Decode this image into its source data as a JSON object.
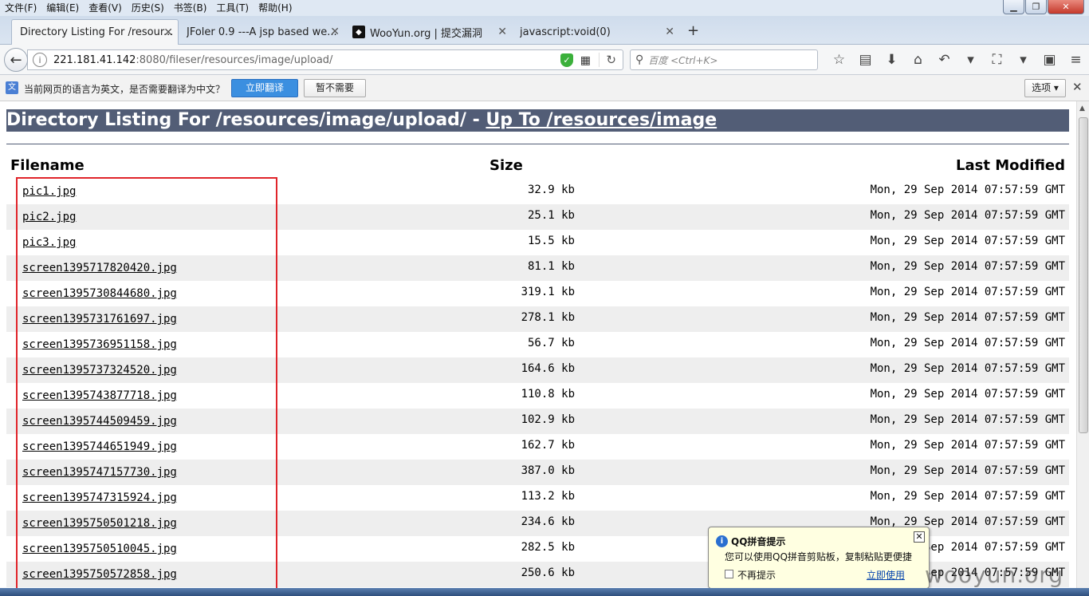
{
  "menubar": [
    "文件(F)",
    "编辑(E)",
    "查看(V)",
    "历史(S)",
    "书签(B)",
    "工具(T)",
    "帮助(H)"
  ],
  "tabs": [
    {
      "label": "Directory Listing For /resour...",
      "active": true
    },
    {
      "label": "JFoler 0.9 ---A jsp based we...",
      "active": false
    },
    {
      "label": "WooYun.org | 提交漏洞",
      "active": false
    },
    {
      "label": "javascript:void(0)",
      "active": false
    }
  ],
  "nav": {
    "url_host": "221.181.41.142",
    "url_path": ":8080/fileser/resources/image/upload/",
    "search_placeholder": "百度 <Ctrl+K>"
  },
  "translate": {
    "message": "当前网页的语言为英文，是否需要翻译为中文？",
    "translate_btn": "立即翻译",
    "decline_btn": "暂不需要",
    "options_btn": "选项 ▾"
  },
  "page": {
    "heading_prefix": "Directory Listing For /resources/image/upload/ - ",
    "heading_link": "Up To /resources/image",
    "col_filename": "Filename",
    "col_size": "Size",
    "col_modified": "Last Modified",
    "files": [
      {
        "name": "pic1.jpg",
        "size": "32.9 kb",
        "modified": "Mon, 29 Sep 2014 07:57:59 GMT"
      },
      {
        "name": "pic2.jpg",
        "size": "25.1 kb",
        "modified": "Mon, 29 Sep 2014 07:57:59 GMT"
      },
      {
        "name": "pic3.jpg",
        "size": "15.5 kb",
        "modified": "Mon, 29 Sep 2014 07:57:59 GMT"
      },
      {
        "name": "screen1395717820420.jpg",
        "size": "81.1 kb",
        "modified": "Mon, 29 Sep 2014 07:57:59 GMT"
      },
      {
        "name": "screen1395730844680.jpg",
        "size": "319.1 kb",
        "modified": "Mon, 29 Sep 2014 07:57:59 GMT"
      },
      {
        "name": "screen1395731761697.jpg",
        "size": "278.1 kb",
        "modified": "Mon, 29 Sep 2014 07:57:59 GMT"
      },
      {
        "name": "screen1395736951158.jpg",
        "size": "56.7 kb",
        "modified": "Mon, 29 Sep 2014 07:57:59 GMT"
      },
      {
        "name": "screen1395737324520.jpg",
        "size": "164.6 kb",
        "modified": "Mon, 29 Sep 2014 07:57:59 GMT"
      },
      {
        "name": "screen1395743877718.jpg",
        "size": "110.8 kb",
        "modified": "Mon, 29 Sep 2014 07:57:59 GMT"
      },
      {
        "name": "screen1395744509459.jpg",
        "size": "102.9 kb",
        "modified": "Mon, 29 Sep 2014 07:57:59 GMT"
      },
      {
        "name": "screen1395744651949.jpg",
        "size": "162.7 kb",
        "modified": "Mon, 29 Sep 2014 07:57:59 GMT"
      },
      {
        "name": "screen1395747157730.jpg",
        "size": "387.0 kb",
        "modified": "Mon, 29 Sep 2014 07:57:59 GMT"
      },
      {
        "name": "screen1395747315924.jpg",
        "size": "113.2 kb",
        "modified": "Mon, 29 Sep 2014 07:57:59 GMT"
      },
      {
        "name": "screen1395750501218.jpg",
        "size": "234.6 kb",
        "modified": "Mon, 29 Sep 2014 07:57:59 GMT"
      },
      {
        "name": "screen1395750510045.jpg",
        "size": "282.5 kb",
        "modified": "Mon, 29 Sep 2014 07:57:59 GMT"
      },
      {
        "name": "screen1395750572858.jpg",
        "size": "250.6 kb",
        "modified": "Mon, 29 Sep 2014 07:57:59 GMT"
      }
    ]
  },
  "qq_popup": {
    "title": "QQ拼音提示",
    "body": "您可以使用QQ拼音剪贴板，复制粘贴更便捷",
    "checkbox_label": "不再提示",
    "link": "立即使用"
  },
  "watermark": "wooyun.org",
  "colors": {
    "heading_bg": "#525d76",
    "alt_row": "#eeeeee",
    "highlight_box": "#e0242a",
    "translate_btn": "#3b8fe0"
  }
}
